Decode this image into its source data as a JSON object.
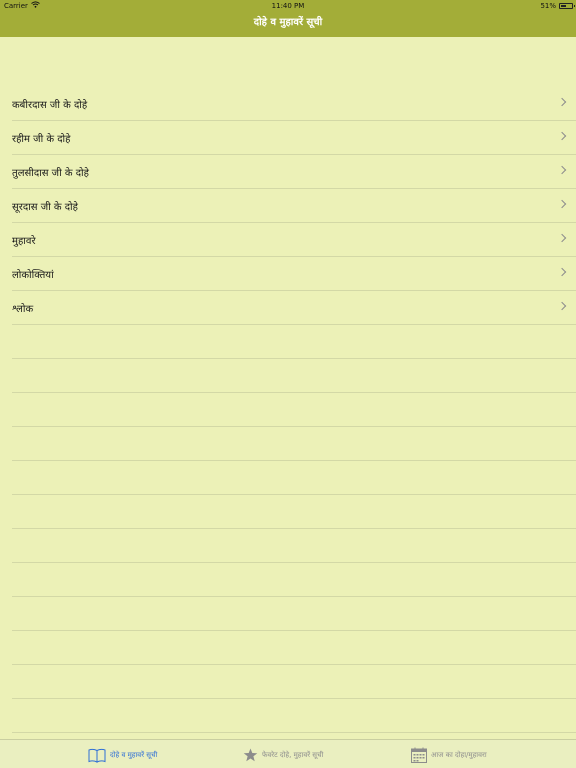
{
  "status_bar": {
    "carrier": "Carrier",
    "time": "11:40 PM",
    "battery": "51%",
    "battery_level": 0.51
  },
  "nav": {
    "title": "दोहे व मुहावरें सूची"
  },
  "list": {
    "items": [
      {
        "label": "कबीरदास जी के दोहे"
      },
      {
        "label": "रहीम जी के दोहे"
      },
      {
        "label": "तुलसीदास जी के दोहे"
      },
      {
        "label": "सूरदास जी के दोहे"
      },
      {
        "label": "मुहावरे"
      },
      {
        "label": "लोकोक्तियां"
      },
      {
        "label": "श्लोक"
      }
    ]
  },
  "tabs": [
    {
      "label": "दोहे व मुहावरें सूची",
      "icon": "book-icon",
      "active": true
    },
    {
      "label": "फेवरेट दोहे, मुहावरें सूची",
      "icon": "star-icon",
      "active": false
    },
    {
      "label": "आज का दोहा/मुहावरा",
      "icon": "calendar-icon",
      "active": false
    }
  ],
  "colors": {
    "nav_background": "#a3ad38",
    "page_background": "#ecf1b7",
    "active_tab": "#2f6fd6",
    "inactive_tab": "#8c8c8c"
  }
}
